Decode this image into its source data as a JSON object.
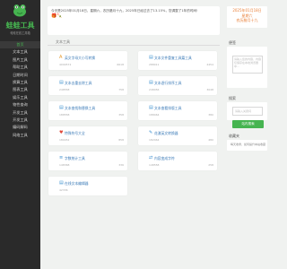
{
  "site": {
    "title": "蛙蛙工具",
    "subtitle": "蛙蛙在线工具箱"
  },
  "nav": [
    {
      "label": "首页",
      "active": true
    },
    {
      "label": "文本工具",
      "active": false
    },
    {
      "label": "图片工具",
      "active": false
    },
    {
      "label": "帮助工具",
      "active": false
    },
    {
      "label": "日期时间",
      "active": false
    },
    {
      "label": "换算工具",
      "active": false
    },
    {
      "label": "图表工具",
      "active": false
    },
    {
      "label": "娱乐工具",
      "active": false
    },
    {
      "label": "物性查询",
      "active": false
    },
    {
      "label": "开发工具",
      "active": false
    },
    {
      "label": "开发工具",
      "active": false
    },
    {
      "label": "编码解码",
      "active": false
    },
    {
      "label": "网络工具",
      "active": false
    }
  ],
  "notice": {
    "text": "今天是2025年01月18日，星期六，农历腊月十九，2025年已经过去了13.15%，您调整了1年的时间! ",
    "icons": "🎁🍡"
  },
  "section": {
    "title": "文本工具"
  },
  "cards": [
    {
      "title": "英文字母大小写转换",
      "left": "4090572",
      "right": "6618",
      "icon": "A",
      "color": "#e69a2e"
    },
    {
      "title": "文本文件重复工具篇工具",
      "left": "288011",
      "right": "4454",
      "icon": "▤",
      "color": "#3a8fd0"
    },
    {
      "title": "文本去重去除工具",
      "left": "248558",
      "right": "758",
      "icon": "▤",
      "color": "#3a8fd0"
    },
    {
      "title": "文本逐行排序工具",
      "left": "248456",
      "right": "3048",
      "icon": "▤",
      "color": "#3a8fd0"
    },
    {
      "title": "文本查找和替换工具",
      "left": "188558",
      "right": "358",
      "icon": "▤",
      "color": "#3a8fd0"
    },
    {
      "title": "文本查看排版工具",
      "left": "188464",
      "right": "380",
      "icon": "▤",
      "color": "#3a8fd0"
    },
    {
      "title": "特殊符号大全",
      "left": "180452",
      "right": "858",
      "icon": "♥",
      "color": "#e0483a"
    },
    {
      "title": "花漾英文转换器",
      "left": "182464",
      "right": "480",
      "icon": "✎",
      "color": "#3a8fd0"
    },
    {
      "title": "字数统计工具",
      "left": "148368",
      "right": "336",
      "icon": "≡",
      "color": "#3a8fd0"
    },
    {
      "title": "内容变成字符",
      "left": "148558",
      "right": "258",
      "icon": "⇄",
      "color": "#3a8fd0"
    },
    {
      "title": "在线文本编辑器",
      "left": "42336",
      "right": "",
      "icon": "▤",
      "color": "#3a8fd0"
    }
  ],
  "right": {
    "date": [
      "2025年01月18日",
      "星期六",
      "农历腊月十九"
    ],
    "note_label": "便签",
    "note_placeholder": "请输入您的内容，内容仅保存在本地浏览器中...",
    "search_label": "搜索",
    "search_placeholder": "请输入关键词",
    "search_button": "站内搜索",
    "fav_label": "收藏夹",
    "fav_text": "每天收录，如何提升本站收藏"
  }
}
